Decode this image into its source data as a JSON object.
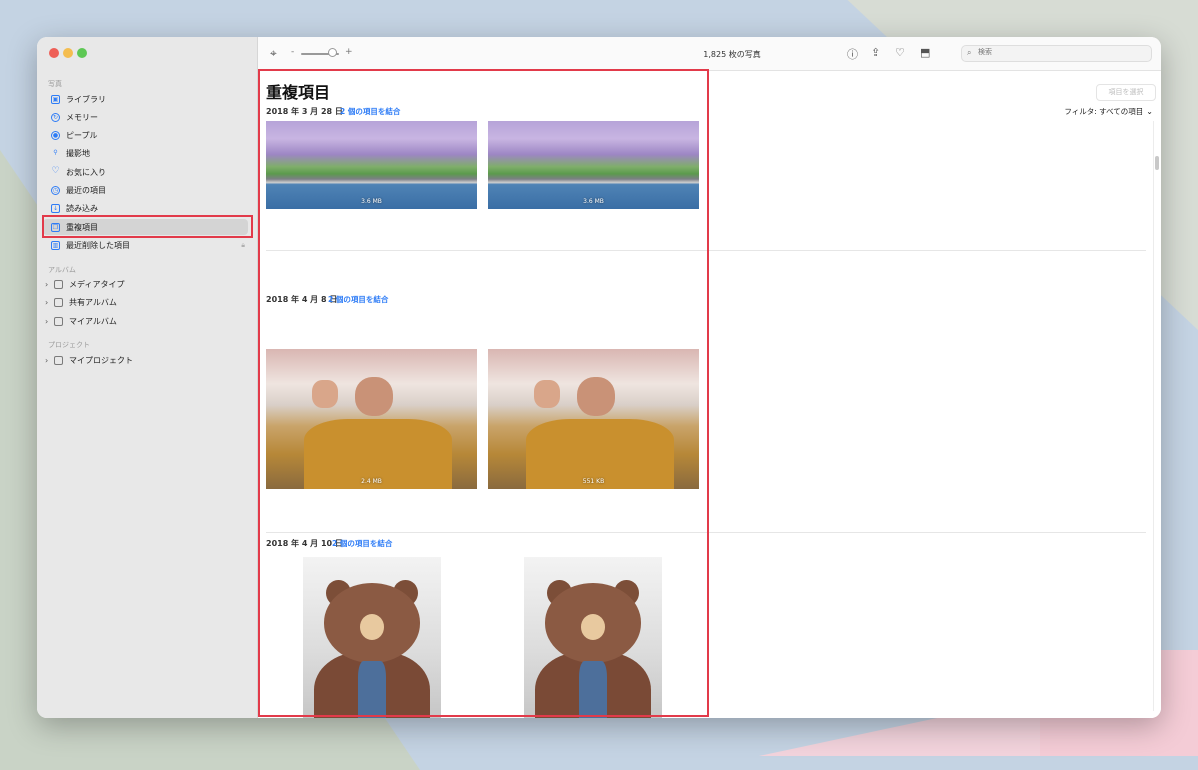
{
  "sidebar": {
    "section_photos": "写真",
    "items": [
      {
        "label": "ライブラリ",
        "icon": "library-icon"
      },
      {
        "label": "メモリー",
        "icon": "memories-icon"
      },
      {
        "label": "ピープル",
        "icon": "people-icon"
      },
      {
        "label": "撮影地",
        "icon": "places-icon"
      },
      {
        "label": "お気に入り",
        "icon": "heart-icon"
      },
      {
        "label": "最近の項目",
        "icon": "clock-icon"
      },
      {
        "label": "読み込み",
        "icon": "import-icon"
      },
      {
        "label": "重複項目",
        "icon": "duplicates-icon",
        "selected": true
      },
      {
        "label": "最近削除した項目",
        "icon": "trash-icon",
        "locked": true
      }
    ],
    "section_albums": "アルバム",
    "albums": [
      {
        "label": "メディアタイプ",
        "icon": "folder-icon"
      },
      {
        "label": "共有アルバム",
        "icon": "shared-album-icon"
      },
      {
        "label": "マイアルバム",
        "icon": "folder-icon"
      }
    ],
    "section_projects": "プロジェクト",
    "projects": [
      {
        "label": "マイプロジェクト",
        "icon": "folder-icon"
      }
    ]
  },
  "toolbar": {
    "zoom_minus": "-",
    "zoom_plus": "+",
    "photo_count": "1,825 枚の写真",
    "search_placeholder": "検索"
  },
  "main": {
    "title": "重複項目",
    "select_button": "項目を選択",
    "filter_label": "フィルタ: すべての項目",
    "groups": [
      {
        "date": "2018 年 3 月 28 日",
        "merge": "2 個の項目を結合",
        "sizes": [
          "3.6 MB",
          "3.6 MB"
        ]
      },
      {
        "date": "2018 年 4 月 8 日",
        "merge": "2 個の項目を結合",
        "sizes": [
          "2.4 MB",
          "551 KB"
        ]
      },
      {
        "date": "2018 年 4 月 10 日",
        "merge": "2 個の項目を結合",
        "sizes": []
      }
    ]
  },
  "colors": {
    "accent": "#2e7cf6",
    "highlight_box": "#e23a4a",
    "sidebar_bg": "#e8e8e8"
  }
}
